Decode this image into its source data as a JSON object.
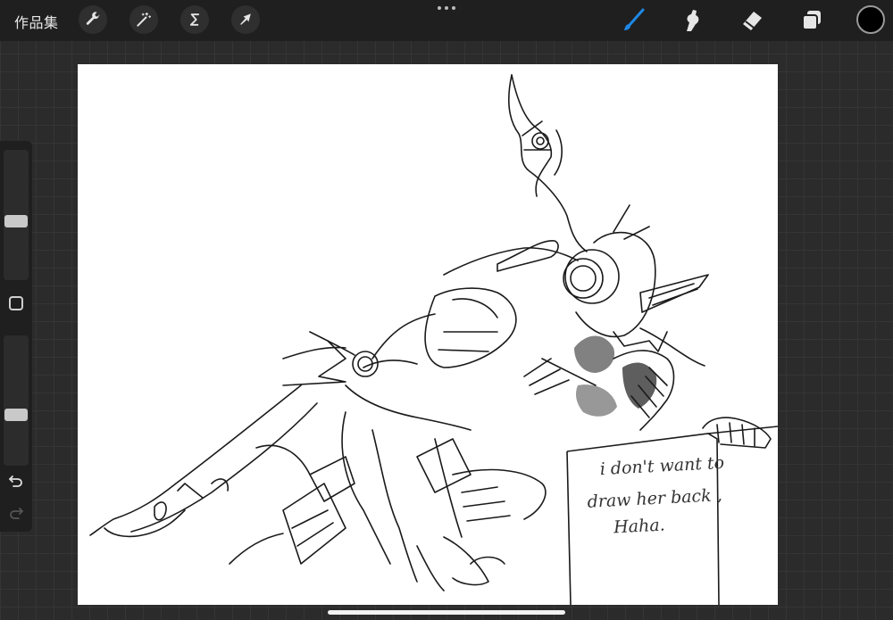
{
  "topbar": {
    "gallery_label": "作品集",
    "left_tools": [
      "wrench-icon",
      "magic-wand-icon",
      "selection-s-icon",
      "transform-arrow-icon"
    ],
    "right_tools": [
      "brush-icon",
      "smudge-icon",
      "eraser-icon",
      "layers-icon"
    ],
    "active_tool": "brush",
    "accent_color": "#1e88e5",
    "current_color": "#000000"
  },
  "sidebar": {
    "brush_size_level": 0.55,
    "opacity_level": 0.62
  },
  "canvas": {
    "sign_lines": [
      "i don't want to",
      "draw her back ,",
      "Haha."
    ]
  }
}
